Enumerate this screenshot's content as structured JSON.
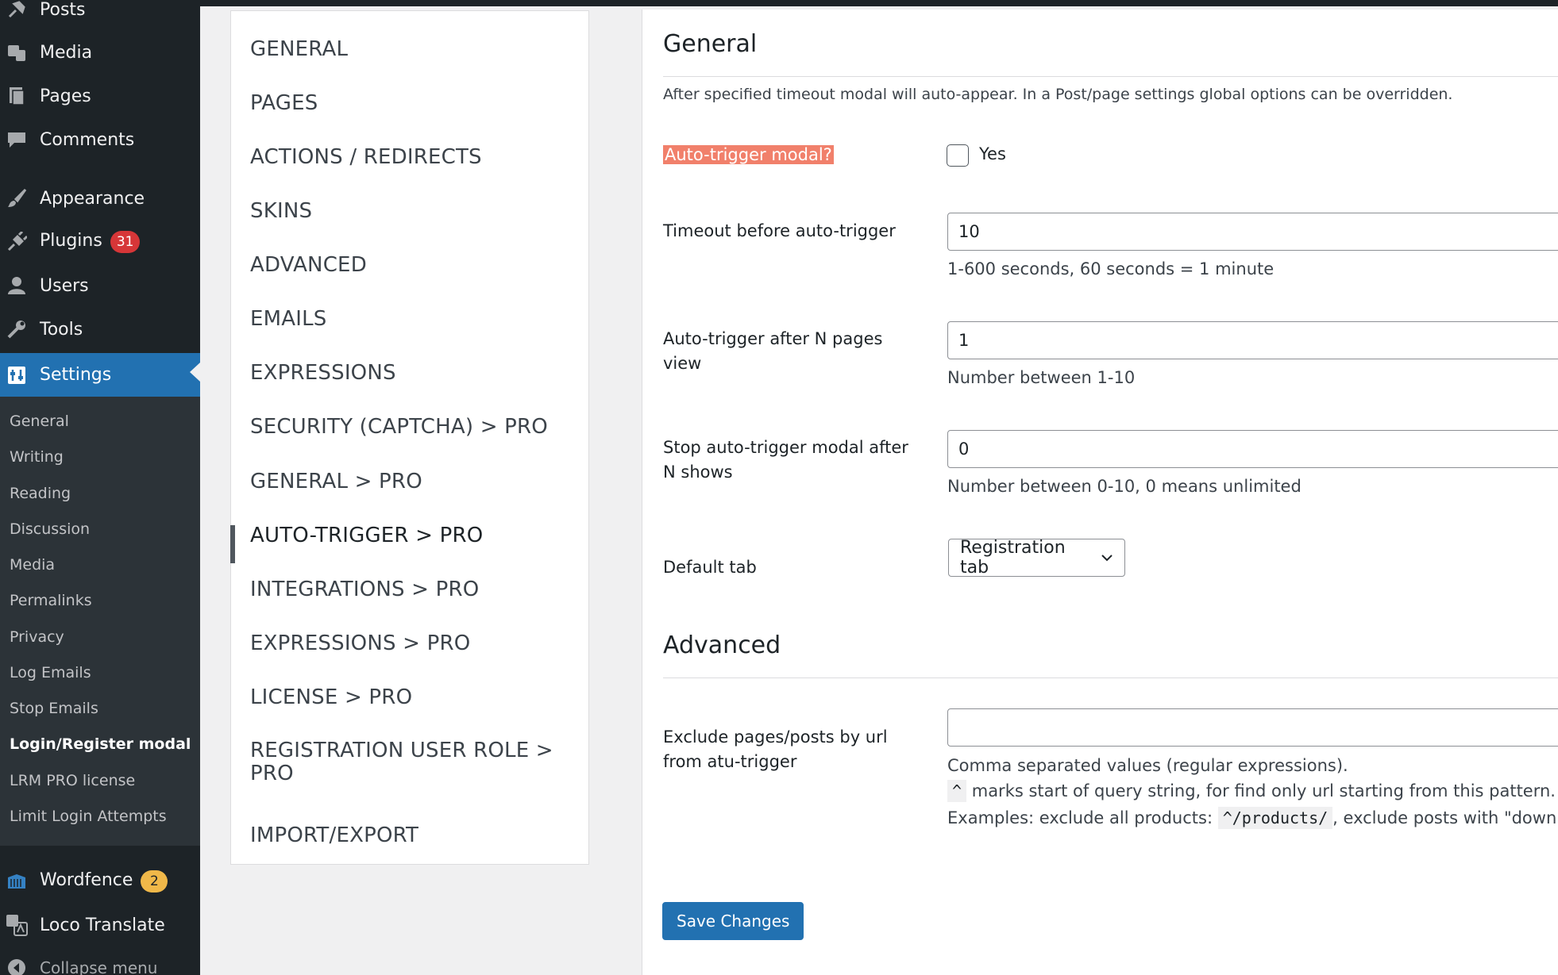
{
  "admin_menu": {
    "items": [
      {
        "name": "posts",
        "label": "Posts",
        "icon": "pin-icon"
      },
      {
        "name": "media",
        "label": "Media",
        "icon": "media-icon"
      },
      {
        "name": "pages",
        "label": "Pages",
        "icon": "pages-icon"
      },
      {
        "name": "comments",
        "label": "Comments",
        "icon": "comment-icon"
      },
      {
        "name": "appearance",
        "label": "Appearance",
        "icon": "brush-icon"
      },
      {
        "name": "plugins",
        "label": "Plugins",
        "icon": "plug-icon",
        "badge": "31"
      },
      {
        "name": "users",
        "label": "Users",
        "icon": "user-icon"
      },
      {
        "name": "tools",
        "label": "Tools",
        "icon": "wrench-icon"
      },
      {
        "name": "settings",
        "label": "Settings",
        "icon": "settings-icon"
      },
      {
        "name": "wordfence",
        "label": "Wordfence",
        "icon": "wordfence-icon",
        "badge": "2"
      },
      {
        "name": "loco-translate",
        "label": "Loco Translate",
        "icon": "translate-icon"
      },
      {
        "name": "collapse",
        "label": "Collapse menu",
        "icon": "collapse-icon"
      }
    ],
    "settings_submenu": [
      "General",
      "Writing",
      "Reading",
      "Discussion",
      "Media",
      "Permalinks",
      "Privacy",
      "Log Emails",
      "Stop Emails",
      "Login/Register modal",
      "LRM PRO license",
      "Limit Login Attempts"
    ],
    "colors": {
      "plugins_badge": "#d63638",
      "wordfence_badge": "#f0b849",
      "current": "#2271b1"
    }
  },
  "tabs": [
    "GENERAL",
    "PAGES",
    "ACTIONS / REDIRECTS",
    "SKINS",
    "ADVANCED",
    "EMAILS",
    "EXPRESSIONS",
    "SECURITY (CAPTCHA) > PRO",
    "GENERAL > PRO",
    "AUTO-TRIGGER > PRO",
    "INTEGRATIONS > PRO",
    "EXPRESSIONS > PRO",
    "LICENSE > PRO",
    "REGISTRATION USER ROLE > PRO",
    "IMPORT/EXPORT"
  ],
  "general": {
    "heading": "General",
    "description": "After specified timeout modal will auto-appear. In a Post/page settings global options can be overridden.",
    "auto_trigger_label": "Auto-trigger modal?",
    "auto_trigger_option": "Yes",
    "timeout_label": "Timeout before auto-trigger",
    "timeout_value": "10",
    "timeout_desc": "1-600 seconds, 60 seconds = 1 minute",
    "pages_label": "Auto-trigger after N pages view",
    "pages_value": "1",
    "pages_desc": "Number between 1-10",
    "stop_label": "Stop auto-trigger modal after N shows",
    "stop_value": "0",
    "stop_desc": "Number between 0-10, 0 means unlimited",
    "default_tab_label": "Default tab",
    "default_tab_value": "Registration tab"
  },
  "advanced": {
    "heading": "Advanced",
    "exclude_label": "Exclude pages/posts by url from atu-trigger",
    "exclude_value": "",
    "exclude_desc_1": "Comma separated values (regular expressions).",
    "caret_code": "^",
    "exclude_desc_2": "marks start of query string, for find only url starting from this pattern.",
    "examples_prefix": "Examples: exclude all products:",
    "products_code": "^/products/",
    "examples_suffix": ", exclude posts with \"downl"
  },
  "save_label": "Save Changes",
  "highlight_color": "#f1806b"
}
